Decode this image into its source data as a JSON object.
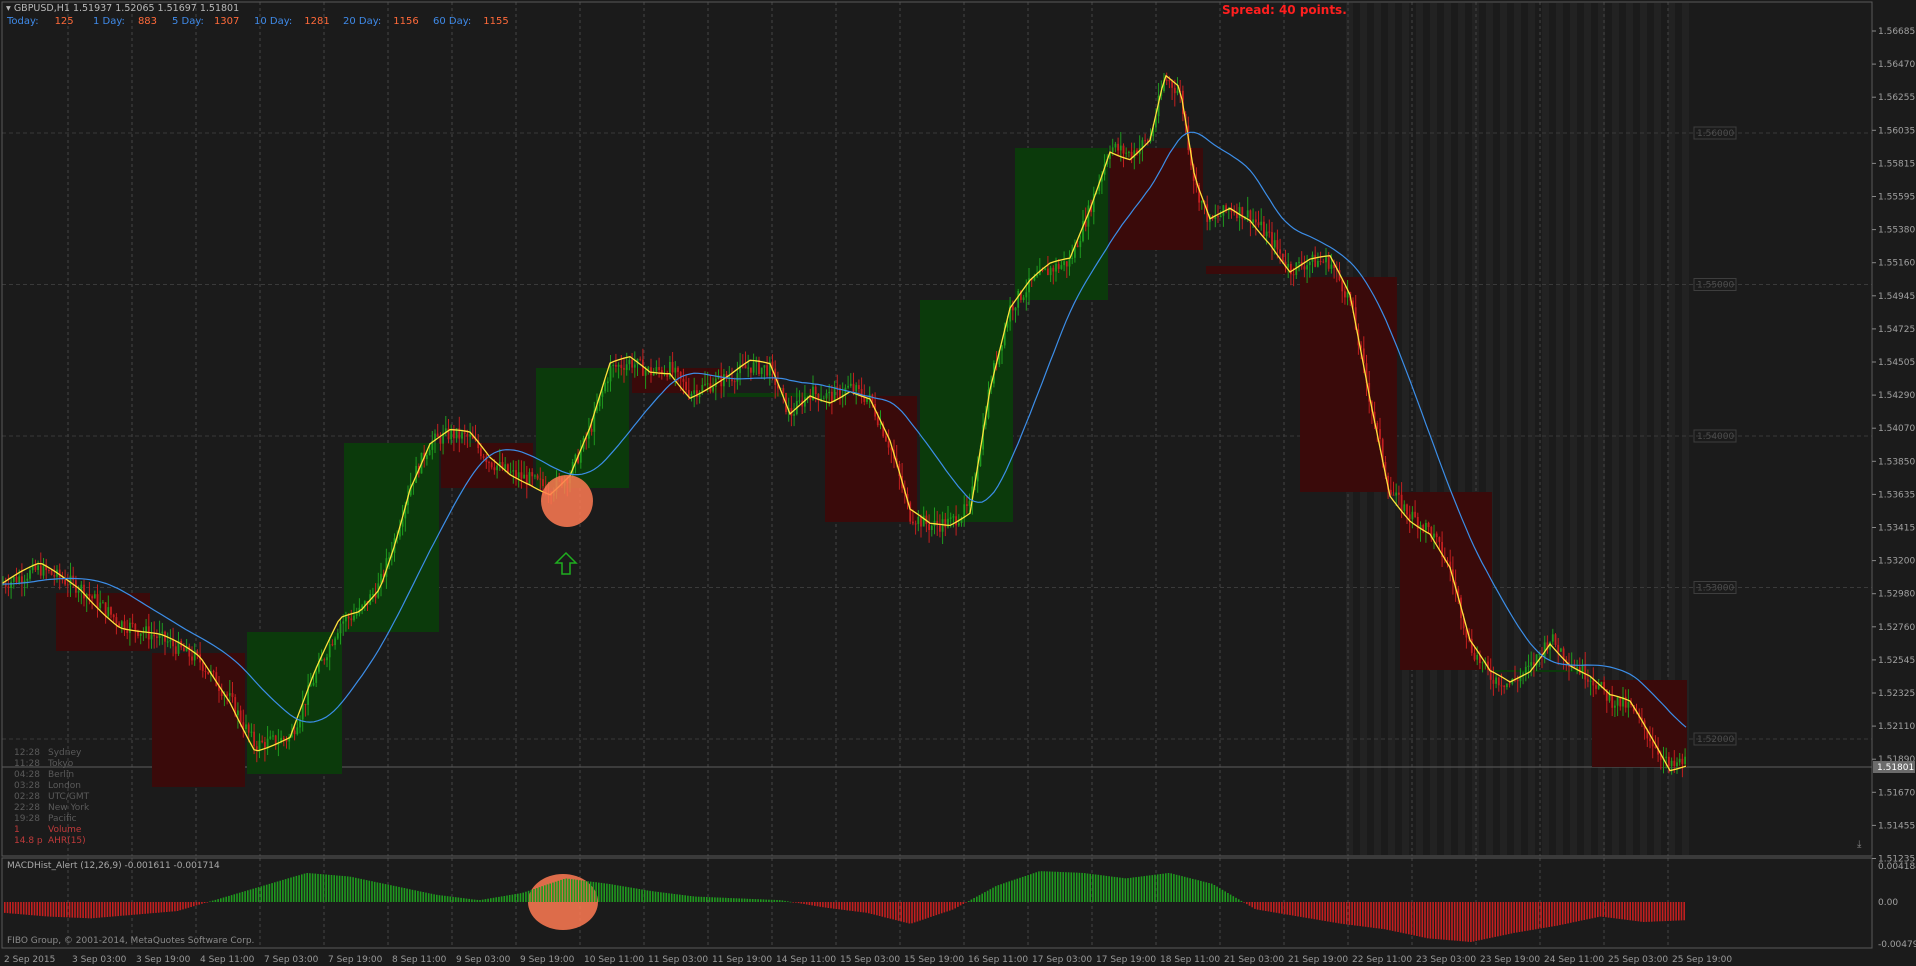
{
  "header": {
    "symbol_line": "GBPUSD,H1  1.51937 1.52065 1.51697 1.51801",
    "spread": "Spread: 40 points."
  },
  "stats": [
    {
      "label": "Today:",
      "value": "125"
    },
    {
      "label": "1 Day:",
      "value": "883"
    },
    {
      "label": "5 Day:",
      "value": "1307"
    },
    {
      "label": "10 Day:",
      "value": "1281"
    },
    {
      "label": "20 Day:",
      "value": "1156"
    },
    {
      "label": "60 Day:",
      "value": "1155"
    }
  ],
  "clocks": [
    {
      "time": "12:28",
      "name": "Sydney"
    },
    {
      "time": "11:28",
      "name": "Tokyo"
    },
    {
      "time": "04:28",
      "name": "Berlin"
    },
    {
      "time": "03:28",
      "name": "London"
    },
    {
      "time": "02:28",
      "name": "UTC/GMT"
    },
    {
      "time": "22:28",
      "name": "New York"
    },
    {
      "time": "19:28",
      "name": "Pacific"
    },
    {
      "time": "1",
      "name": "Volume"
    },
    {
      "time": "14.8 p",
      "name": "AHR(15)"
    }
  ],
  "macd": {
    "title": "MACDHist_Alert (12,26,9)  -0.001611 -0.001714",
    "scale": [
      "0.004184",
      "0.00",
      "-0.004790"
    ]
  },
  "copyright": "FIBO Group, © 2001-2014, MetaQuotes Software Corp.",
  "price_axis": [
    "1.56685",
    "1.56470",
    "1.56255",
    "1.56035",
    "1.55815",
    "1.55595",
    "1.55380",
    "1.55160",
    "1.54945",
    "1.54725",
    "1.54505",
    "1.54290",
    "1.54070",
    "1.53850",
    "1.53635",
    "1.53415",
    "1.53200",
    "1.52980",
    "1.52760",
    "1.52545",
    "1.52325",
    "1.52110",
    "1.51890",
    "1.51670",
    "1.51455",
    "1.51235"
  ],
  "round_levels": [
    "1.56000",
    "1.55000",
    "1.54000",
    "1.53000",
    "1.52000"
  ],
  "current_price": "1.51801",
  "time_axis": [
    "2 Sep 2015",
    "3 Sep 03:00",
    "3 Sep 19:00",
    "4 Sep 11:00",
    "7 Sep 03:00",
    "7 Sep 19:00",
    "8 Sep 11:00",
    "9 Sep 03:00",
    "9 Sep 19:00",
    "10 Sep 11:00",
    "11 Sep 03:00",
    "11 Sep 19:00",
    "14 Sep 11:00",
    "15 Sep 03:00",
    "15 Sep 19:00",
    "16 Sep 11:00",
    "17 Sep 03:00",
    "17 Sep 19:00",
    "18 Sep 11:00",
    "21 Sep 03:00",
    "21 Sep 19:00",
    "22 Sep 11:00",
    "23 Sep 03:00",
    "23 Sep 19:00",
    "24 Sep 11:00",
    "25 Sep 03:00",
    "25 Sep 19:00"
  ],
  "colors": {
    "background": "#1b1b1b",
    "bull_box": "#0b3a0b",
    "bear_box": "#3a0a0a",
    "bull_candle": "#1f9a1f",
    "bear_candle": "#c21f1f",
    "fast_ma": "#ffe23c",
    "slow_ma": "#3c8ee8",
    "highlight": "#ff7a52"
  },
  "chart_data": {
    "type": "candlestick",
    "price_range": [
      1.5123,
      1.5679
    ],
    "fast_ma": [
      1.53,
      1.529,
      1.531,
      1.53,
      1.526,
      1.525,
      1.523,
      1.519,
      1.518,
      1.522,
      1.528,
      1.533,
      1.539,
      1.54,
      1.539,
      1.537,
      1.537,
      1.539,
      1.543,
      1.544,
      1.542,
      1.543,
      1.543,
      1.542,
      1.535,
      1.534,
      1.546,
      1.55,
      1.557,
      1.556,
      1.563,
      1.555,
      1.554,
      1.55,
      1.551,
      1.543,
      1.535,
      1.533,
      1.529,
      1.525,
      1.524,
      1.521,
      1.518,
      1.519
    ],
    "slow_ma": [
      1.533,
      1.531,
      1.529,
      1.527,
      1.524,
      1.522,
      1.524,
      1.527,
      1.532,
      1.535,
      1.536,
      1.538,
      1.541,
      1.542,
      1.543,
      1.542,
      1.54,
      1.538,
      1.543,
      1.547,
      1.551,
      1.554,
      1.553,
      1.551,
      1.548,
      1.543,
      1.536,
      1.531,
      1.527,
      1.524
    ],
    "macd_hist": [
      -0.0006,
      -0.0008,
      -0.0009,
      -0.0007,
      -0.0005,
      0.0002,
      0.0009,
      0.0016,
      0.0014,
      0.0009,
      0.0004,
      0.0001,
      0.0005,
      0.0013,
      0.001,
      0.0006,
      0.0003,
      0.0002,
      0.0001,
      -0.0003,
      -0.0006,
      -0.0012,
      -0.0004,
      0.0009,
      0.0017,
      0.0016,
      0.0013,
      0.0016,
      0.001,
      -0.0004,
      -0.0008,
      -0.0012,
      -0.0015,
      -0.002,
      -0.0022,
      -0.0017,
      -0.0013,
      -0.0008,
      -0.0011,
      -0.001
    ]
  }
}
